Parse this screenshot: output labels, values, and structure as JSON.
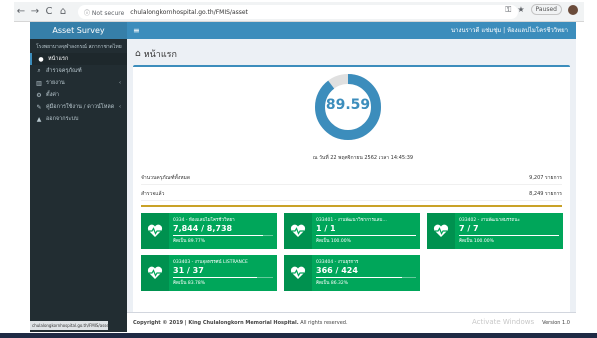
{
  "browser": {
    "back": "←",
    "forward": "→",
    "reload": "C",
    "home": "⌂",
    "secure_label": "ⓘ Not secure",
    "url": "chulalongkornhospital.go.th/FMIS/asset",
    "profile": "Paused"
  },
  "app": {
    "brand": "Asset Survey",
    "toggle": "≡",
    "user": "นางนราวดี แช่มชุ่ม  |  ห้องแลปไมโครชีววิทยา"
  },
  "sidebar": {
    "user_panel": "โรงพยาบาลจุฬาลงกรณ์ สภากาชาดไทย",
    "items": [
      {
        "icon": "●",
        "label": "หน้าแรก"
      },
      {
        "icon": "⌕",
        "label": "สำรวจครุภัณฑ์"
      },
      {
        "icon": "▥",
        "label": "รายงาน"
      },
      {
        "icon": "⚙",
        "label": "ตั้งค่า"
      },
      {
        "icon": "✎",
        "label": "คู่มือการใช้งาน / ดาวน์โหลด"
      },
      {
        "icon": "▲",
        "label": "ออกจากระบบ"
      }
    ],
    "status_url": "chulalongkornhospital.go.th/FMIS/asset#"
  },
  "content": {
    "page_title": "หน้าแรก",
    "donut_value": "89.59",
    "donut_fraction": 0.8959,
    "date_line": "ณ วันที่ 22 พฤศจิกายน 2562  เวลา 14:45:39",
    "stats": [
      {
        "label": "จำนวนครุภัณฑ์ทั้งหมด",
        "value": "9,207  รายการ"
      },
      {
        "label": "สำรวจแล้ว",
        "value": "8,249  รายการ"
      }
    ],
    "cards": [
      {
        "title": "0334 - ห้องแลปไมโครชีววิทยา",
        "count": "7,844 / 8,738",
        "pct": "คิดเป็น 89.77%",
        "fraction": 0.8977
      },
      {
        "title": "033401 - งานพัฒนาวิชาการแลบ…",
        "count": "1 / 1",
        "pct": "คิดเป็น 100.00%",
        "fraction": 1.0
      },
      {
        "title": "033402 - งานพัฒนาสมรรถนะ",
        "count": "7 / 7",
        "pct": "คิดเป็น 100.00%",
        "fraction": 1.0
      },
      {
        "title": "033403 - งานจุลทรรศน์ LISTRANCE",
        "count": "31 / 37",
        "pct": "คิดเป็น 83.78%",
        "fraction": 0.8378
      },
      {
        "title": "033404 - งานธุรการ",
        "count": "366 / 424",
        "pct": "คิดเป็น 86.32%",
        "fraction": 0.8632
      }
    ]
  },
  "footer": {
    "copyright_bold": "Copyright © 2019 | King Chulalongkorn Memorial Hospital.",
    "copyright_rest": " All rights reserved.",
    "activate": "Activate Windows",
    "version": "Version 1.0"
  },
  "colors": {
    "primary": "#3c8dbc",
    "success": "#00a65a",
    "sidebar": "#222d32",
    "gold": "#c9a227"
  }
}
